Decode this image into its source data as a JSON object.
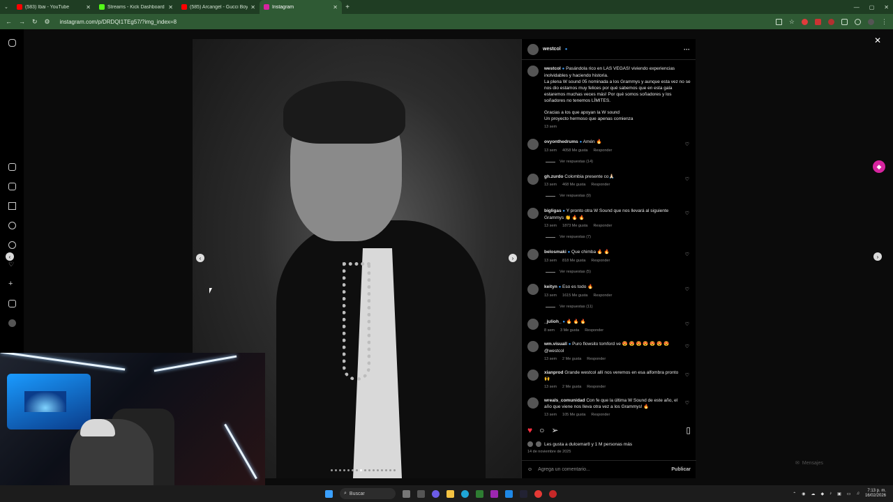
{
  "browser": {
    "tabs": [
      {
        "title": "(583) Ibai - YouTube",
        "color": "#ff0000"
      },
      {
        "title": "Streams - Kick Dashboard",
        "color": "#53fc18"
      },
      {
        "title": "(585) Arcangel - Gucci Boys Cl...",
        "color": "#ff0000"
      },
      {
        "title": "Instagram",
        "color": "#d6249f"
      }
    ],
    "url": "instagram.com/p/DRDQI1TEg57/?img_index=8"
  },
  "post": {
    "username": "westcol",
    "caption_line1": "Pasándola rico en LAS VEGAS! viviendo experiencias inolvidables y haciendo historia.",
    "caption_line2": "La plena W sound 05 nominada a los Grammys y aunque esta vez no se nos dio estamos muy felices por qué sabemos que en esta gala estaremos muchas veces más! Por qué somos soñadores y los soñadores no tenemos LÍMITES.",
    "caption_line3": "Gracias a los que apoyan la W sound",
    "caption_line4": "Un proyecto hermoso que apenas comienza",
    "caption_time": "13 sem",
    "likes_text": "Les gusta a dulcemar8 y 1 M personas más",
    "date": "14 de noviembre de 2025",
    "comment_placeholder": "Agrega un comentario...",
    "publish": "Publicar"
  },
  "comments": [
    {
      "user": "ovyonthedrums",
      "text": "Amén 🔥",
      "time": "13 sem",
      "likes": "4058 Me gusta",
      "reply": "Responder",
      "replies": "Ver respuestas (14)"
    },
    {
      "user": "gh.zurdo",
      "text": "Colombia presente co🙏🏻",
      "time": "13 sem",
      "likes": "468 Me gusta",
      "reply": "Responder",
      "replies": "Ver respuestas (9)"
    },
    {
      "user": "bigligas",
      "text": "Y pronto otra W Sound que nos llevará al siguiente Grammys 👏 🔥 🔥",
      "time": "13 sem",
      "likes": "1873 Me gusta",
      "reply": "Responder",
      "replies": "Ver respuestas (7)"
    },
    {
      "user": "belosmaki",
      "text": "Que chimba 🔥 🔥",
      "time": "13 sem",
      "likes": "818 Me gusta",
      "reply": "Responder",
      "replies": "Ver respuestas (5)"
    },
    {
      "user": "keityn",
      "text": "Eso es todo 🔥",
      "time": "13 sem",
      "likes": "1615 Me gusta",
      "reply": "Responder",
      "replies": "Ver respuestas (11)"
    },
    {
      "user": "_julioh_",
      "text": "🔥 🔥 🔥",
      "time": "8 sem",
      "likes": "3 Me gusta",
      "reply": "Responder",
      "replies": ""
    },
    {
      "user": "wm.visuall",
      "text": "Puro flowsito tomford ve 😍 😍 😍 😍 😍 😍 😍 @westcol",
      "time": "13 sem",
      "likes": "2 Me gusta",
      "reply": "Responder",
      "replies": ""
    },
    {
      "user": "xianprod",
      "text": "Grande westcol allí nos veremos en esa alfombra pronto 🙌",
      "time": "13 sem",
      "likes": "2 Me gusta",
      "reply": "Responder",
      "replies": ""
    },
    {
      "user": "wreals_comunidad",
      "text": "Con fe que la última W Sound de este año, el año que viene nos lleva otra vez a los Grammys! 🔥",
      "time": "13 sem",
      "likes": "105 Me gusta",
      "reply": "Responder",
      "replies": ""
    }
  ],
  "messages_label": "Mensajes",
  "taskbar": {
    "search": "Buscar",
    "time": "7:13 p. m.",
    "date": "16/02/2026"
  }
}
